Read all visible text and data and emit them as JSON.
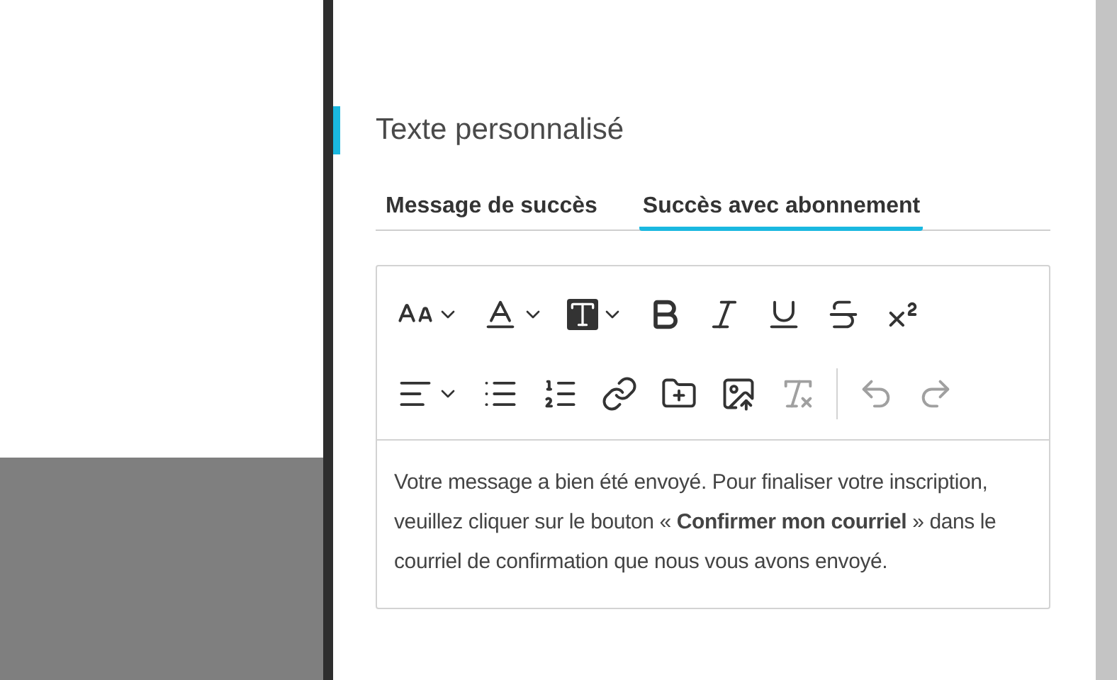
{
  "section": {
    "title": "Texte personnalisé"
  },
  "tabs": [
    {
      "label": "Message de succès",
      "selected": false
    },
    {
      "label": "Succès avec abonnement",
      "selected": true
    }
  ],
  "toolbar": {
    "rows": [
      [
        {
          "kind": "font-size",
          "dropdown": true,
          "disabled": false
        },
        {
          "kind": "text-color",
          "dropdown": true,
          "disabled": false
        },
        {
          "kind": "highlight",
          "dropdown": true,
          "disabled": false
        },
        {
          "kind": "bold",
          "dropdown": false,
          "disabled": false
        },
        {
          "kind": "italic",
          "dropdown": false,
          "disabled": false
        },
        {
          "kind": "underline",
          "dropdown": false,
          "disabled": false
        },
        {
          "kind": "strike",
          "dropdown": false,
          "disabled": false
        },
        {
          "kind": "superscript",
          "dropdown": false,
          "disabled": false
        }
      ],
      [
        {
          "kind": "align",
          "dropdown": true,
          "disabled": false
        },
        {
          "kind": "bullet-list",
          "dropdown": false,
          "disabled": false
        },
        {
          "kind": "numbered-list",
          "dropdown": false,
          "disabled": false
        },
        {
          "kind": "link",
          "dropdown": false,
          "disabled": false
        },
        {
          "kind": "file",
          "dropdown": false,
          "disabled": false
        },
        {
          "kind": "image",
          "dropdown": false,
          "disabled": false
        },
        {
          "kind": "clear-format",
          "dropdown": false,
          "disabled": true
        },
        {
          "kind": "separator"
        },
        {
          "kind": "undo",
          "dropdown": false,
          "disabled": true
        },
        {
          "kind": "redo",
          "dropdown": false,
          "disabled": true
        }
      ]
    ]
  },
  "editor": {
    "content": "Votre message a bien été envoyé. Pour finaliser votre inscription, veuillez cliquer sur le bouton « **Confirmer mon courriel** » dans le courriel de confirmation que nous vous avons envoyé."
  }
}
